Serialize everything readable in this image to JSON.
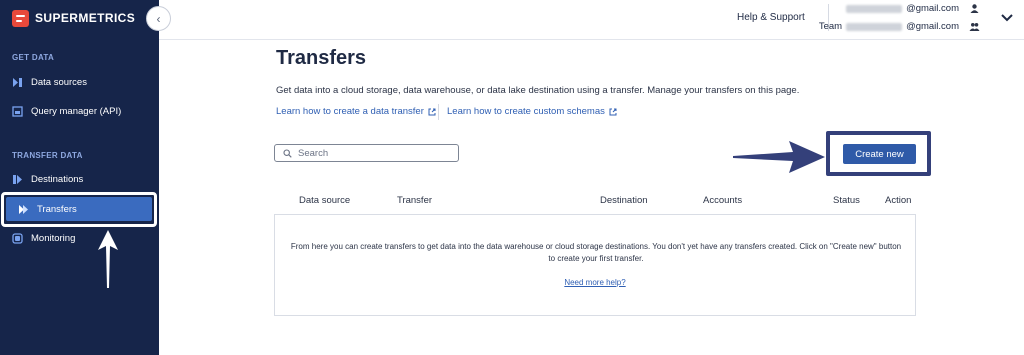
{
  "brand": {
    "name": "SUPERMETRICS"
  },
  "sidebar": {
    "sections": [
      {
        "label": "GET DATA"
      },
      {
        "label": "TRANSFER DATA"
      }
    ],
    "items": [
      {
        "label": "Data sources",
        "icon": "data-sources-icon"
      },
      {
        "label": "Query manager (API)",
        "icon": "query-manager-icon"
      },
      {
        "label": "Destinations",
        "icon": "destinations-icon"
      },
      {
        "label": "Transfers",
        "icon": "transfers-icon",
        "active": true
      },
      {
        "label": "Monitoring",
        "icon": "monitoring-icon"
      }
    ]
  },
  "topbar": {
    "help": "Help & Support",
    "account_email_suffix": "@gmail.com",
    "team_prefix": "Team",
    "team_email_suffix": "@gmail.com"
  },
  "main": {
    "title": "Transfers",
    "description": "Get data into a cloud storage, data warehouse, or data lake destination using a transfer. Manage your transfers on this page.",
    "links": [
      {
        "label": "Learn how to create a data transfer"
      },
      {
        "label": "Learn how to create custom schemas"
      }
    ],
    "search_placeholder": "Search",
    "create_button": "Create new",
    "columns": [
      "Data source",
      "Transfer",
      "Destination",
      "Accounts",
      "Status",
      "Action"
    ],
    "empty_message": "From here you can create transfers to get data into the data warehouse or cloud storage destinations. You don't yet have any transfers created. Click on \"Create new\" button to create your first transfer.",
    "help_link": "Need more help?"
  },
  "colors": {
    "sidebar_bg": "#16254a",
    "active_item": "#3a6bbf",
    "primary_button": "#2f5aa8",
    "link": "#2f5fb3",
    "annotation": "#34407a"
  }
}
